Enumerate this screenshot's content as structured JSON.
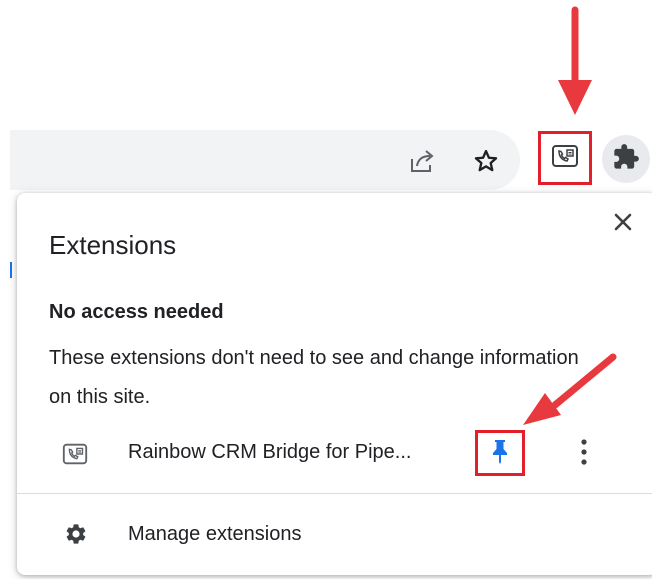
{
  "toolbar": {
    "share_icon": "share-icon",
    "bookmark_icon": "star-icon",
    "extension_icon": "rainbow-crm-extension-icon",
    "extensions_menu_icon": "puzzle-piece-icon"
  },
  "popup": {
    "title": "Extensions",
    "close_icon": "close-icon",
    "section": {
      "heading": "No access needed",
      "description": "These extensions don't need to see and change information on this site."
    },
    "extension": {
      "name": "Rainbow CRM Bridge for Pipe...",
      "icon": "rainbow-crm-icon",
      "pin_icon": "pin-icon",
      "more_icon": "more-vert-icon"
    },
    "manage": {
      "label": "Manage extensions",
      "icon": "gear-icon"
    }
  },
  "colors": {
    "highlight": "#e2202b",
    "arrow": "#e8393f",
    "pin_blue": "#1a73e8",
    "icon_gray": "#5f6368",
    "omnibox_bg": "#f1f3f4"
  }
}
